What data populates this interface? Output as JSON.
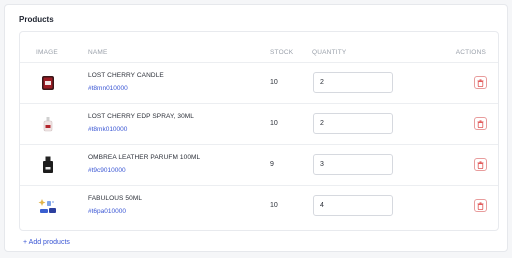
{
  "section": {
    "title": "Products"
  },
  "table": {
    "headers": {
      "image": "IMAGE",
      "name": "NAME",
      "stock": "STOCK",
      "quantity": "QUANTITY",
      "actions": "ACTIONS"
    },
    "rows": [
      {
        "name": "LOST CHERRY CANDLE",
        "sku": "#t8mn010000",
        "stock": "10",
        "quantity": "2",
        "thumb": "candle-icon"
      },
      {
        "name": "LOST CHERRY EDP SPRAY, 30ML",
        "sku": "#t8mk010000",
        "stock": "10",
        "quantity": "2",
        "thumb": "perfume-bottle-icon"
      },
      {
        "name": "OMBREA LEATHER PARUFM 100ML",
        "sku": "#t9c9010000",
        "stock": "9",
        "quantity": "3",
        "thumb": "perfume-bottle-icon"
      },
      {
        "name": "FABULOUS 50ML",
        "sku": "#t6pa010000",
        "stock": "10",
        "quantity": "4",
        "thumb": "sparkle-product-icon"
      }
    ]
  },
  "add_products_label": "+ Add products",
  "colors": {
    "link": "#3a56d4",
    "delete": "#e05555",
    "border": "#e6e8ec"
  }
}
